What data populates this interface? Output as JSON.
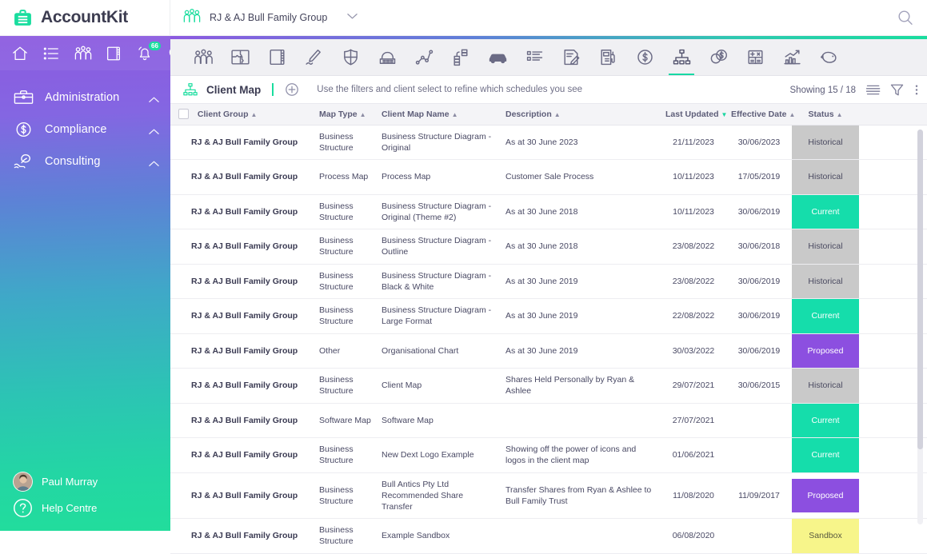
{
  "brand": {
    "name": "AccountKit",
    "logo_icon": "briefcase-logo-icon"
  },
  "header": {
    "client_selector": {
      "label": "RJ & AJ Bull Family Group",
      "icon": "people-group-icon",
      "chevron": "chevron-down-icon"
    },
    "search_icon": "search-icon"
  },
  "sidebar": {
    "quick_icons": [
      {
        "name": "home-icon"
      },
      {
        "name": "list-icon"
      },
      {
        "name": "people-group-icon"
      },
      {
        "name": "book-icon"
      },
      {
        "name": "bell-icon",
        "badge": "66"
      },
      {
        "name": "search-icon"
      }
    ],
    "nav": [
      {
        "label": "Administration",
        "icon": "toolbox-icon",
        "chevron": "chevron-up-icon"
      },
      {
        "label": "Compliance",
        "icon": "dollar-circle-icon",
        "chevron": "chevron-up-icon"
      },
      {
        "label": "Consulting",
        "icon": "hand-leaf-icon",
        "chevron": "chevron-up-icon"
      }
    ],
    "user": {
      "label": "Paul Murray",
      "avatar": "user-avatar"
    },
    "help": {
      "label": "Help Centre",
      "icon": "question-circle-icon"
    }
  },
  "modulebar": {
    "items": [
      {
        "name": "people-group-icon",
        "active": false
      },
      {
        "name": "puzzle-map-icon",
        "active": false
      },
      {
        "name": "notebook-icon",
        "active": false
      },
      {
        "name": "pen-signature-icon",
        "active": false
      },
      {
        "name": "shield-icon",
        "active": false
      },
      {
        "name": "telephone-icon",
        "active": false
      },
      {
        "name": "line-chart-icon",
        "active": false
      },
      {
        "name": "stacked-coins-icon",
        "active": false
      },
      {
        "name": "car-icon",
        "active": false
      },
      {
        "name": "checklist-icon",
        "active": false
      },
      {
        "name": "document-edit-icon",
        "active": false
      },
      {
        "name": "fuel-pump-icon",
        "active": false
      },
      {
        "name": "dollar-coin-icon",
        "active": false
      },
      {
        "name": "org-chart-icon",
        "active": true
      },
      {
        "name": "two-coins-icon",
        "active": false
      },
      {
        "name": "calculator-icon",
        "active": false
      },
      {
        "name": "bar-growth-icon",
        "active": false
      },
      {
        "name": "piggy-bank-icon",
        "active": false
      }
    ]
  },
  "page": {
    "icon": "org-chart-icon",
    "title": "Client Map",
    "add_icon": "plus-circle-icon",
    "hint": "Use the filters and client select to refine which schedules you see",
    "showing": "Showing 15 / 18",
    "right_icons": [
      {
        "name": "list-view-icon"
      },
      {
        "name": "filter-icon"
      },
      {
        "name": "more-vertical-icon"
      }
    ]
  },
  "table": {
    "columns": [
      {
        "key": "group",
        "label": "Client Group",
        "sort": "asc",
        "active": false
      },
      {
        "key": "type",
        "label": "Map Type",
        "sort": "asc",
        "active": false
      },
      {
        "key": "name",
        "label": "Client Map Name",
        "sort": "asc",
        "active": false
      },
      {
        "key": "desc",
        "label": "Description",
        "sort": "asc",
        "active": false
      },
      {
        "key": "upd",
        "label": "Last Updated",
        "sort": "desc",
        "active": true
      },
      {
        "key": "eff",
        "label": "Effective Date",
        "sort": "asc",
        "active": false
      },
      {
        "key": "status",
        "label": "Status",
        "sort": "asc",
        "active": false
      }
    ],
    "rows": [
      {
        "group": "RJ & AJ Bull Family Group",
        "type": "Business Structure",
        "name": "Business Structure Diagram - Original",
        "desc": "As at 30 June 2023",
        "upd": "21/11/2023",
        "eff": "30/06/2023",
        "status": "Historical"
      },
      {
        "group": "RJ & AJ Bull Family Group",
        "type": "Process Map",
        "name": "Process Map",
        "desc": "Customer Sale Process",
        "upd": "10/11/2023",
        "eff": "17/05/2019",
        "status": "Historical"
      },
      {
        "group": "RJ & AJ Bull Family Group",
        "type": "Business Structure",
        "name": "Business Structure Diagram - Original (Theme #2)",
        "desc": "As at 30 June 2018",
        "upd": "10/11/2023",
        "eff": "30/06/2019",
        "status": "Current"
      },
      {
        "group": "RJ & AJ Bull Family Group",
        "type": "Business Structure",
        "name": "Business Structure Diagram - Outline",
        "desc": "As at 30 June 2018",
        "upd": "23/08/2022",
        "eff": "30/06/2018",
        "status": "Historical"
      },
      {
        "group": "RJ & AJ Bull Family Group",
        "type": "Business Structure",
        "name": "Business Structure Diagram - Black & White",
        "desc": "As at 30 June 2019",
        "upd": "23/08/2022",
        "eff": "30/06/2019",
        "status": "Historical"
      },
      {
        "group": "RJ & AJ Bull Family Group",
        "type": "Business Structure",
        "name": "Business Structure Diagram - Large Format",
        "desc": "As at 30 June 2019",
        "upd": "22/08/2022",
        "eff": "30/06/2019",
        "status": "Current"
      },
      {
        "group": "RJ & AJ Bull Family Group",
        "type": "Other",
        "name": "Organisational Chart",
        "desc": "As at 30 June 2019",
        "upd": "30/03/2022",
        "eff": "30/06/2019",
        "status": "Proposed"
      },
      {
        "group": "RJ & AJ Bull Family Group",
        "type": "Business Structure",
        "name": "Client Map",
        "desc": "Shares Held Personally by Ryan & Ashlee",
        "upd": "29/07/2021",
        "eff": "30/06/2015",
        "status": "Historical"
      },
      {
        "group": "RJ & AJ Bull Family Group",
        "type": "Software Map",
        "name": "Software Map",
        "desc": "",
        "upd": "27/07/2021",
        "eff": "",
        "status": "Current"
      },
      {
        "group": "RJ & AJ Bull Family Group",
        "type": "Business Structure",
        "name": "New Dext Logo Example",
        "desc": "Showing off the power of icons and logos in the client map",
        "upd": "01/06/2021",
        "eff": "",
        "status": "Current"
      },
      {
        "group": "RJ & AJ Bull Family Group",
        "type": "Business Structure",
        "name": "Bull Antics Pty Ltd Recommended Share Transfer",
        "desc": "Transfer Shares from Ryan & Ashlee to Bull Family Trust",
        "upd": "11/08/2020",
        "eff": "11/09/2017",
        "status": "Proposed"
      },
      {
        "group": "RJ & AJ Bull Family Group",
        "type": "Business Structure",
        "name": "Example Sandbox",
        "desc": "",
        "upd": "06/08/2020",
        "eff": "",
        "status": "Sandbox"
      }
    ]
  },
  "colors": {
    "brand_teal": "#19dd9e",
    "brand_purple": "#8c5ae0",
    "status_historical": "#c9c9c9",
    "status_current": "#15ddab",
    "status_proposed": "#8c4fe0",
    "status_sandbox": "#f7f58a"
  }
}
